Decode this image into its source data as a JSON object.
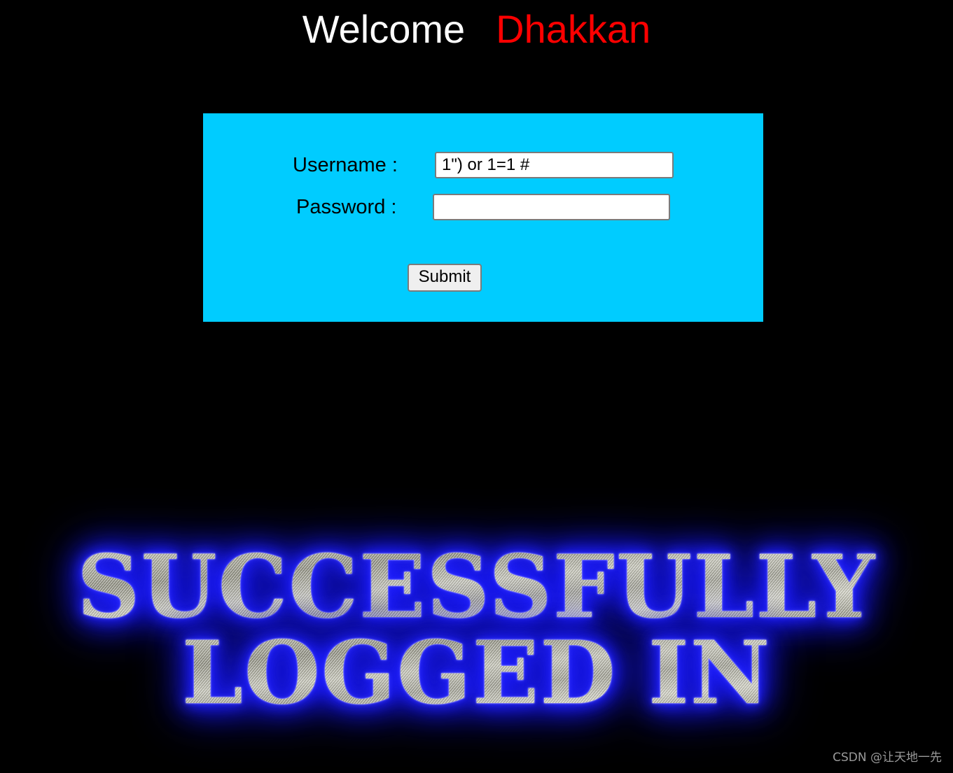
{
  "header": {
    "greeting": "Welcome",
    "username": "Dhakkan",
    "greeting_color": "#ffffff",
    "username_color": "#ff0000"
  },
  "login_form": {
    "panel_color": "#00ccff",
    "username_label": "Username :",
    "username_value": "1\") or 1=1 #",
    "username_placeholder": "",
    "password_label": "Password :",
    "password_value": "",
    "password_placeholder": "",
    "submit_label": "Submit"
  },
  "banner": {
    "line1": "SUCCESSFULLY",
    "line2": "LOGGED IN",
    "glow_color": "#2020ff",
    "fill_color": "#b8b8ab"
  },
  "watermark": {
    "text": "CSDN @让天地一先"
  },
  "page": {
    "background_color": "#000000"
  }
}
